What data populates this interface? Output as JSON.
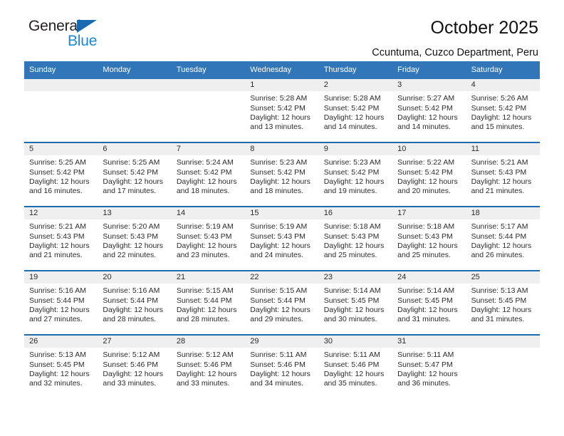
{
  "brand": {
    "word_top": "General",
    "word_bottom": "Blue",
    "triangle_icon": "triangle-logo-icon",
    "color_dark": "#231f20",
    "color_blue": "#1b87d4"
  },
  "header": {
    "title": "October 2025",
    "subtitle": "Ccuntuma, Cuzco Department, Peru"
  },
  "theme": {
    "header_bar": "#3076b8",
    "week_divider": "#1e6cb0",
    "date_band": "#efefef",
    "text": "#2b2b2b"
  },
  "weekdays": [
    "Sunday",
    "Monday",
    "Tuesday",
    "Wednesday",
    "Thursday",
    "Friday",
    "Saturday"
  ],
  "weeks": [
    [
      {
        "day": "",
        "lines": []
      },
      {
        "day": "",
        "lines": []
      },
      {
        "day": "",
        "lines": []
      },
      {
        "day": "1",
        "lines": [
          "Sunrise: 5:28 AM",
          "Sunset: 5:42 PM",
          "Daylight: 12 hours",
          "and 13 minutes."
        ]
      },
      {
        "day": "2",
        "lines": [
          "Sunrise: 5:28 AM",
          "Sunset: 5:42 PM",
          "Daylight: 12 hours",
          "and 14 minutes."
        ]
      },
      {
        "day": "3",
        "lines": [
          "Sunrise: 5:27 AM",
          "Sunset: 5:42 PM",
          "Daylight: 12 hours",
          "and 14 minutes."
        ]
      },
      {
        "day": "4",
        "lines": [
          "Sunrise: 5:26 AM",
          "Sunset: 5:42 PM",
          "Daylight: 12 hours",
          "and 15 minutes."
        ]
      }
    ],
    [
      {
        "day": "5",
        "lines": [
          "Sunrise: 5:25 AM",
          "Sunset: 5:42 PM",
          "Daylight: 12 hours",
          "and 16 minutes."
        ]
      },
      {
        "day": "6",
        "lines": [
          "Sunrise: 5:25 AM",
          "Sunset: 5:42 PM",
          "Daylight: 12 hours",
          "and 17 minutes."
        ]
      },
      {
        "day": "7",
        "lines": [
          "Sunrise: 5:24 AM",
          "Sunset: 5:42 PM",
          "Daylight: 12 hours",
          "and 18 minutes."
        ]
      },
      {
        "day": "8",
        "lines": [
          "Sunrise: 5:23 AM",
          "Sunset: 5:42 PM",
          "Daylight: 12 hours",
          "and 18 minutes."
        ]
      },
      {
        "day": "9",
        "lines": [
          "Sunrise: 5:23 AM",
          "Sunset: 5:42 PM",
          "Daylight: 12 hours",
          "and 19 minutes."
        ]
      },
      {
        "day": "10",
        "lines": [
          "Sunrise: 5:22 AM",
          "Sunset: 5:42 PM",
          "Daylight: 12 hours",
          "and 20 minutes."
        ]
      },
      {
        "day": "11",
        "lines": [
          "Sunrise: 5:21 AM",
          "Sunset: 5:43 PM",
          "Daylight: 12 hours",
          "and 21 minutes."
        ]
      }
    ],
    [
      {
        "day": "12",
        "lines": [
          "Sunrise: 5:21 AM",
          "Sunset: 5:43 PM",
          "Daylight: 12 hours",
          "and 21 minutes."
        ]
      },
      {
        "day": "13",
        "lines": [
          "Sunrise: 5:20 AM",
          "Sunset: 5:43 PM",
          "Daylight: 12 hours",
          "and 22 minutes."
        ]
      },
      {
        "day": "14",
        "lines": [
          "Sunrise: 5:19 AM",
          "Sunset: 5:43 PM",
          "Daylight: 12 hours",
          "and 23 minutes."
        ]
      },
      {
        "day": "15",
        "lines": [
          "Sunrise: 5:19 AM",
          "Sunset: 5:43 PM",
          "Daylight: 12 hours",
          "and 24 minutes."
        ]
      },
      {
        "day": "16",
        "lines": [
          "Sunrise: 5:18 AM",
          "Sunset: 5:43 PM",
          "Daylight: 12 hours",
          "and 25 minutes."
        ]
      },
      {
        "day": "17",
        "lines": [
          "Sunrise: 5:18 AM",
          "Sunset: 5:43 PM",
          "Daylight: 12 hours",
          "and 25 minutes."
        ]
      },
      {
        "day": "18",
        "lines": [
          "Sunrise: 5:17 AM",
          "Sunset: 5:44 PM",
          "Daylight: 12 hours",
          "and 26 minutes."
        ]
      }
    ],
    [
      {
        "day": "19",
        "lines": [
          "Sunrise: 5:16 AM",
          "Sunset: 5:44 PM",
          "Daylight: 12 hours",
          "and 27 minutes."
        ]
      },
      {
        "day": "20",
        "lines": [
          "Sunrise: 5:16 AM",
          "Sunset: 5:44 PM",
          "Daylight: 12 hours",
          "and 28 minutes."
        ]
      },
      {
        "day": "21",
        "lines": [
          "Sunrise: 5:15 AM",
          "Sunset: 5:44 PM",
          "Daylight: 12 hours",
          "and 28 minutes."
        ]
      },
      {
        "day": "22",
        "lines": [
          "Sunrise: 5:15 AM",
          "Sunset: 5:44 PM",
          "Daylight: 12 hours",
          "and 29 minutes."
        ]
      },
      {
        "day": "23",
        "lines": [
          "Sunrise: 5:14 AM",
          "Sunset: 5:45 PM",
          "Daylight: 12 hours",
          "and 30 minutes."
        ]
      },
      {
        "day": "24",
        "lines": [
          "Sunrise: 5:14 AM",
          "Sunset: 5:45 PM",
          "Daylight: 12 hours",
          "and 31 minutes."
        ]
      },
      {
        "day": "25",
        "lines": [
          "Sunrise: 5:13 AM",
          "Sunset: 5:45 PM",
          "Daylight: 12 hours",
          "and 31 minutes."
        ]
      }
    ],
    [
      {
        "day": "26",
        "lines": [
          "Sunrise: 5:13 AM",
          "Sunset: 5:45 PM",
          "Daylight: 12 hours",
          "and 32 minutes."
        ]
      },
      {
        "day": "27",
        "lines": [
          "Sunrise: 5:12 AM",
          "Sunset: 5:46 PM",
          "Daylight: 12 hours",
          "and 33 minutes."
        ]
      },
      {
        "day": "28",
        "lines": [
          "Sunrise: 5:12 AM",
          "Sunset: 5:46 PM",
          "Daylight: 12 hours",
          "and 33 minutes."
        ]
      },
      {
        "day": "29",
        "lines": [
          "Sunrise: 5:11 AM",
          "Sunset: 5:46 PM",
          "Daylight: 12 hours",
          "and 34 minutes."
        ]
      },
      {
        "day": "30",
        "lines": [
          "Sunrise: 5:11 AM",
          "Sunset: 5:46 PM",
          "Daylight: 12 hours",
          "and 35 minutes."
        ]
      },
      {
        "day": "31",
        "lines": [
          "Sunrise: 5:11 AM",
          "Sunset: 5:47 PM",
          "Daylight: 12 hours",
          "and 36 minutes."
        ]
      },
      {
        "day": "",
        "lines": []
      }
    ]
  ]
}
